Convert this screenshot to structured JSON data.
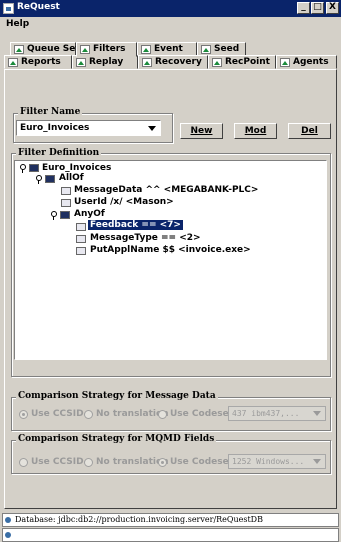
{
  "window": {
    "title": "ReQuest",
    "minimize": "_",
    "maximize": "□",
    "close": "X"
  },
  "menu": {
    "help": "Help"
  },
  "tabs_row1": [
    {
      "label": "Queue Sets"
    },
    {
      "label": "Filters"
    },
    {
      "label": "Event"
    },
    {
      "label": "Seed"
    }
  ],
  "tabs_row2": [
    {
      "label": "Reports"
    },
    {
      "label": "Replay"
    },
    {
      "label": "Recovery"
    },
    {
      "label": "RecPoint"
    },
    {
      "label": "Agents"
    }
  ],
  "filter_name": {
    "legend": "Filter Name",
    "selected": "Euro_Invoices",
    "new_label": "New",
    "mod_label": "Mod",
    "del_label": "Del"
  },
  "filter_definition": {
    "legend": "Filter Definition",
    "nodes": [
      "Euro_Invoices",
      "AllOf",
      "MessageData ^^ <MEGABANK-PLC>",
      "UserId /x/ <Mason>",
      "AnyOf",
      "Feedback == <7>",
      "MessageType == <2>",
      "PutApplName $$ <invoice.exe>"
    ]
  },
  "message_data": {
    "legend": "Comparison Strategy for Message Data",
    "opt1": "Use CCSID",
    "opt2": "No translation",
    "opt3": "Use Codeset",
    "codeset": "437  ibm437,..."
  },
  "mqmd": {
    "legend": "Comparison Strategy for MQMD Fields",
    "opt1": "Use CCSID",
    "opt2": "No translation",
    "opt3": "Use Codeset",
    "codeset": "1252  Windows..."
  },
  "status": {
    "database": "Database: jdbc:db2://production.invoicing.server/ReQuestDB"
  }
}
